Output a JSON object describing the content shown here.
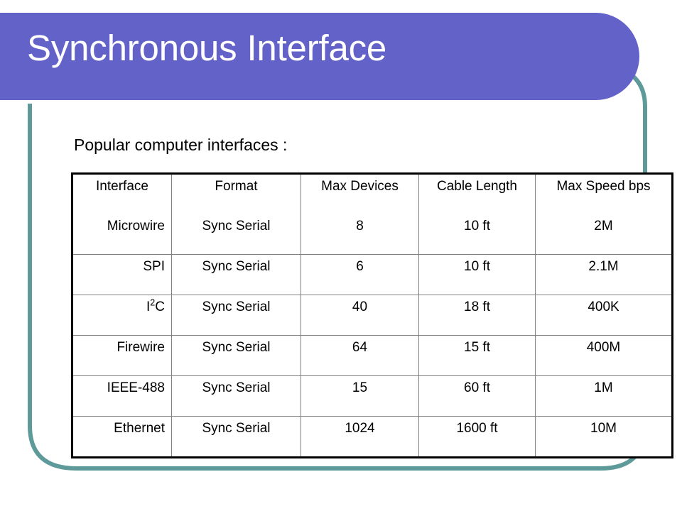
{
  "slide": {
    "title": "Synchronous Interface",
    "subtitle": "Popular computer interfaces :"
  },
  "colors": {
    "header_purple": "#6362c9",
    "deco_teal": "#5f9a9a",
    "rule_white": "#ffffff",
    "table_border": "#000000",
    "cell_border": "#808080",
    "text": "#000000"
  },
  "table": {
    "columns": [
      "Interface",
      "Format",
      "Max Devices",
      "Cable Length",
      "Max Speed bps"
    ],
    "rows": [
      {
        "interface": "Microwire",
        "interface_sup": "",
        "interface_tail": "",
        "format": "Sync Serial",
        "max_devices": "8",
        "cable_length": "10 ft",
        "max_speed": "2M"
      },
      {
        "interface": "SPI",
        "interface_sup": "",
        "interface_tail": "",
        "format": "Sync Serial",
        "max_devices": "6",
        "cable_length": "10 ft",
        "max_speed": "2.1M"
      },
      {
        "interface": "I",
        "interface_sup": "2",
        "interface_tail": "C",
        "format": "Sync Serial",
        "max_devices": "40",
        "cable_length": "18 ft",
        "max_speed": "400K"
      },
      {
        "interface": "Firewire",
        "interface_sup": "",
        "interface_tail": "",
        "format": "Sync Serial",
        "max_devices": "64",
        "cable_length": "15 ft",
        "max_speed": "400M"
      },
      {
        "interface": "IEEE-488",
        "interface_sup": "",
        "interface_tail": "",
        "format": "Sync Serial",
        "max_devices": "15",
        "cable_length": "60 ft",
        "max_speed": "1M"
      },
      {
        "interface": "Ethernet",
        "interface_sup": "",
        "interface_tail": "",
        "format": "Sync Serial",
        "max_devices": "1024",
        "cable_length": "1600 ft",
        "max_speed": "10M"
      }
    ]
  }
}
